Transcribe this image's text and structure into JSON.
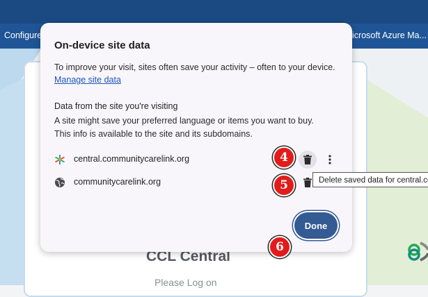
{
  "browser": {
    "bookmarks": [
      {
        "label": "Configure"
      },
      {
        "label": "icrosoft Azure Ma..."
      }
    ]
  },
  "background_page": {
    "title": "CCL Central",
    "subtitle": "Please Log on"
  },
  "dialog": {
    "title": "On-device site data",
    "intro": "To improve your visit, sites often save your activity – often to your device.",
    "manage_link": "Manage site data",
    "section_heading": "Data from the site you're visiting",
    "section_description": "A site might save your preferred language or items you want to buy.\nThis info is available to the site and its subdomains.",
    "sites": [
      {
        "domain": "central.communitycarelink.org",
        "icon": "asterisk-favicon-icon"
      },
      {
        "domain": "communitycarelink.org",
        "icon": "globe-icon"
      }
    ],
    "tooltip": "Delete saved data for central.communitycarelink.org",
    "done_label": "Done"
  },
  "annotations": [
    {
      "number": "4"
    },
    {
      "number": "5"
    },
    {
      "number": "6"
    }
  ],
  "colors": {
    "badge": "#e31b1b",
    "done_button": "#345b94",
    "link": "#1a56b8",
    "browser_bar": "#1b4a83"
  }
}
